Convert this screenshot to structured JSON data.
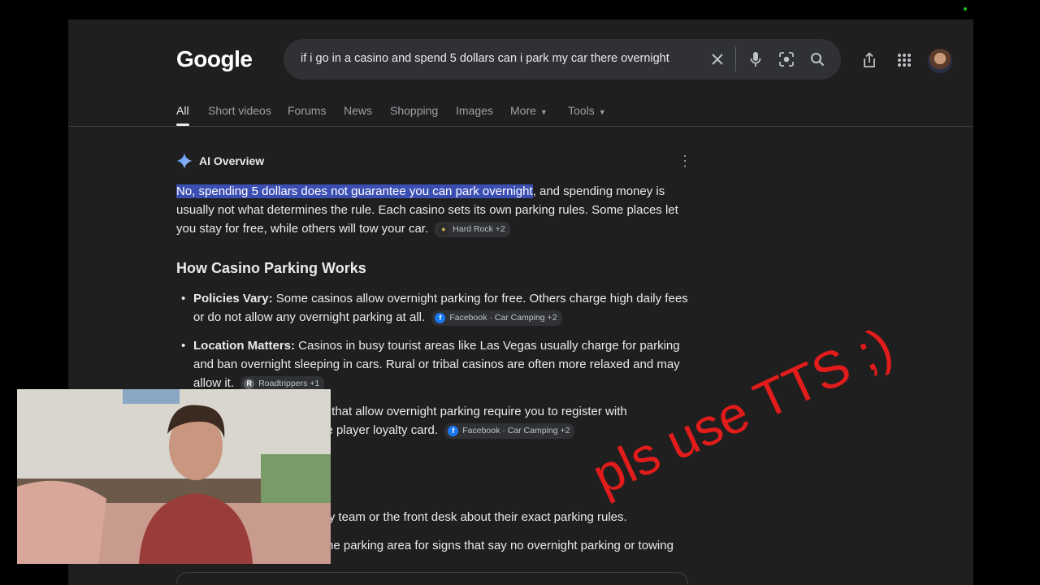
{
  "header": {
    "logo": "Google",
    "search_query": "if i go in a casino and spend 5 dollars can i park my car there overnight"
  },
  "tabs": [
    {
      "label": "All",
      "active": true
    },
    {
      "label": "Short videos"
    },
    {
      "label": "Forums"
    },
    {
      "label": "News"
    },
    {
      "label": "Shopping"
    },
    {
      "label": "Images"
    },
    {
      "label": "More"
    },
    {
      "label": "Tools"
    }
  ],
  "ai_overview": {
    "title": "AI Overview",
    "highlight": "No, spending 5 dollars does not guarantee you can park overnight",
    "intro_rest": ", and spending money is usually not what determines the rule. Each casino sets its own parking rules. Some places let you stay for free, while others will tow your car.",
    "intro_source": "Hard Rock +2",
    "section_title": "How Casino Parking Works",
    "bullets": [
      {
        "bold": "Policies Vary:",
        "text": " Some casinos allow overnight parking for free. Others charge high daily fees or do not allow any overnight parking at all.",
        "source": "Facebook · Car Camping +2"
      },
      {
        "bold": "Location Matters:",
        "text": " Casinos in busy tourist areas like Las Vegas usually charge for parking and ban overnight sleeping in cars. Rural or tribal casinos are often more relaxed and may allow it.",
        "source": "Roadtrippers +1"
      },
      {
        "partial": "ots that allow overnight parking require you to register with",
        "partial2": "free player loyalty card.",
        "source": "Facebook · Car Camping +2"
      },
      {
        "partial": "urity team or the front desk about their exact parking rules."
      },
      {
        "partial": "he parking area for signs that say no overnight parking or towing"
      }
    ]
  },
  "overlay": {
    "text": "pls use TTS ;)"
  },
  "colors": {
    "bg": "#1f1f1f",
    "highlight": "#3b4fb3",
    "overlay": "#e21b1b"
  }
}
